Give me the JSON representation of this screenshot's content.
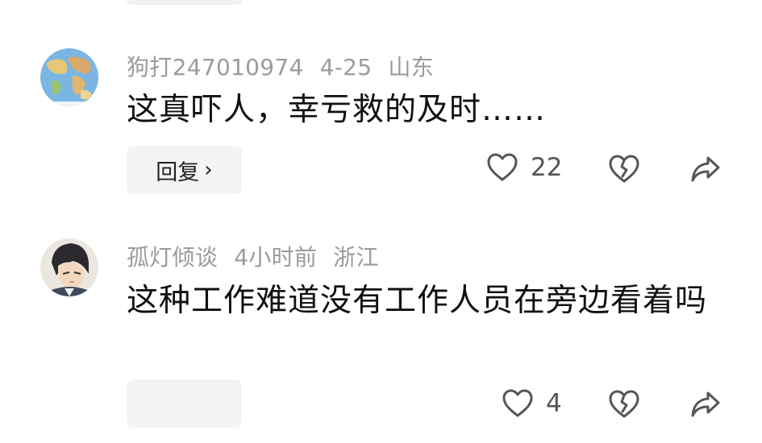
{
  "comments": [
    {
      "username": "狗打247010974",
      "date": "4-25",
      "location": "山东",
      "text": "这真吓人，幸亏救的及时……",
      "reply_label": "回复",
      "reply_chevron": "›",
      "like_count": "22",
      "avatar": "globe-map-avatar"
    },
    {
      "username": "孤灯倾谈",
      "date": "4小时前",
      "location": "浙江",
      "text": "这种工作难道没有工作人员在旁边看着吗",
      "reply_label": "",
      "like_count": "4",
      "avatar": "anime-character-avatar"
    }
  ],
  "icons": {
    "like": "heart-outline-icon",
    "dislike": "broken-heart-icon",
    "share": "share-arrow-icon"
  },
  "colors": {
    "meta_text": "#9b9b9b",
    "body_text": "#111111",
    "button_bg": "#f4f4f4"
  }
}
